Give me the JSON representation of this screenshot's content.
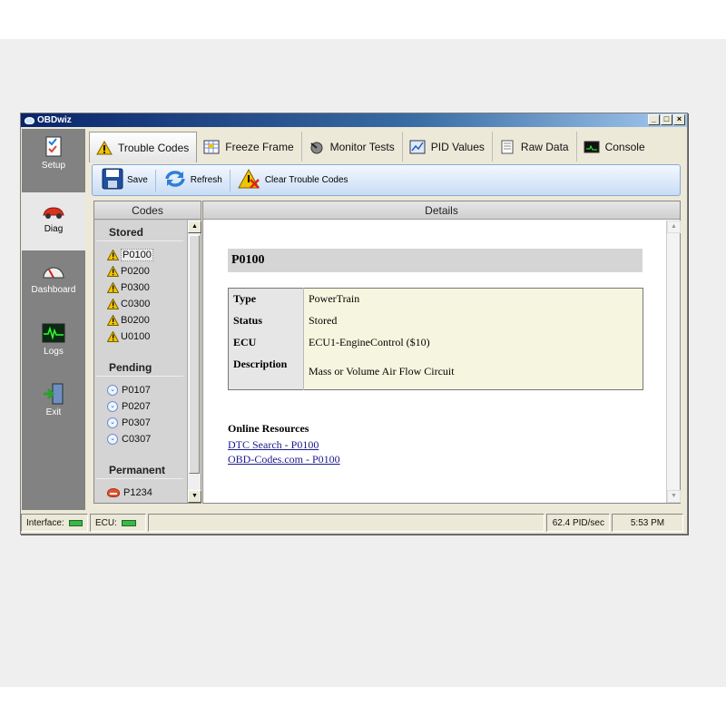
{
  "window": {
    "title": "OBDwiz"
  },
  "nav": [
    {
      "label": "Setup",
      "icon": "checklist-icon"
    },
    {
      "label": "Diag",
      "icon": "car-icon"
    },
    {
      "label": "Dashboard",
      "icon": "gauge-icon"
    },
    {
      "label": "Logs",
      "icon": "waveform-icon"
    },
    {
      "label": "Exit",
      "icon": "exit-door-icon"
    }
  ],
  "tabs": [
    {
      "label": "Trouble Codes",
      "icon": "warning-icon",
      "active": true
    },
    {
      "label": "Freeze Frame",
      "icon": "grid-icon"
    },
    {
      "label": "Monitor Tests",
      "icon": "stethoscope-icon"
    },
    {
      "label": "PID Values",
      "icon": "chart-icon"
    },
    {
      "label": "Raw Data",
      "icon": "document-icon"
    },
    {
      "label": "Console",
      "icon": "terminal-icon"
    }
  ],
  "toolbar": {
    "save": "Save",
    "refresh": "Refresh",
    "clear": "Clear Trouble Codes"
  },
  "codes": {
    "header": "Codes",
    "stored_title": "Stored",
    "stored": [
      "P0100",
      "P0200",
      "P0300",
      "C0300",
      "B0200",
      "U0100"
    ],
    "pending_title": "Pending",
    "pending": [
      "P0107",
      "P0207",
      "P0307",
      "C0307"
    ],
    "permanent_title": "Permanent",
    "permanent": [
      "P1234"
    ]
  },
  "details": {
    "header": "Details",
    "code": "P0100",
    "rows": [
      {
        "key": "Type",
        "value": "PowerTrain"
      },
      {
        "key": "Status",
        "value": "Stored"
      },
      {
        "key": "ECU",
        "value": "ECU1-EngineControl ($10)"
      },
      {
        "key": "Description",
        "value": "Mass or Volume Air Flow Circuit"
      }
    ],
    "resources_title": "Online Resources",
    "links": [
      "DTC Search - P0100",
      "OBD-Codes.com - P0100"
    ]
  },
  "status": {
    "interface": "Interface:",
    "ecu": "ECU:",
    "rate": "62.4 PID/sec",
    "time": "5:53 PM"
  },
  "colors": {
    "led_ok": "#3db54a",
    "warning": "#f2c300",
    "link": "#1a1a8f"
  }
}
